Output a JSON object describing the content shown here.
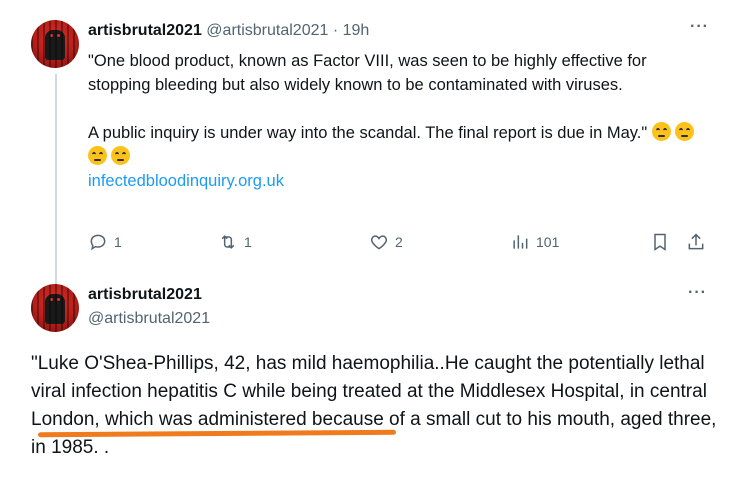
{
  "post1": {
    "display_name": "artisbrutal2021",
    "handle": "@artisbrutal2021",
    "separator": "·",
    "time": "19h",
    "more_label": "···",
    "paragraph1": "\"One  blood product, known as Factor VIII, was seen to be highly effective for stopping bleeding but also widely known to be contaminated with viruses.",
    "paragraph2": "A public inquiry is under way into the scandal. The final report is due in May.\"",
    "emoji_name": "face-with-rolling-eyes-emoji",
    "emoji_count": 4,
    "link_text": "infectedbloodinquiry.org.uk",
    "actions": {
      "reply_count": "1",
      "repost_count": "1",
      "like_count": "2",
      "views_count": "101"
    },
    "icons": {
      "reply": "reply-icon",
      "repost": "repost-icon",
      "like": "heart-icon",
      "views": "views-chart-icon",
      "bookmark": "bookmark-icon",
      "share": "share-icon"
    }
  },
  "post2": {
    "display_name": "artisbrutal2021",
    "handle": "@artisbrutal2021",
    "more_label": "···",
    "body": "\"Luke O'Shea-Phillips, 42, has mild haemophilia..He caught the potentially lethal viral infection hepatitis C while being  treated at the Middlesex Hospital, in central London, which was  administered because of a small cut to his mouth, aged three, in 1985. ."
  },
  "colors": {
    "link": "#1d9bf0",
    "secondary_text": "#536471",
    "annotation_underline": "#f07a1e",
    "thread_line": "#cfd9de"
  }
}
